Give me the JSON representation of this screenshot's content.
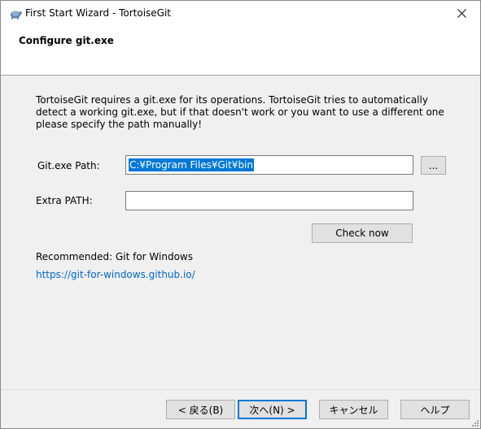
{
  "window": {
    "title": "First Start Wizard - TortoiseGit"
  },
  "header": {
    "title": "Configure git.exe"
  },
  "body": {
    "description": "TortoiseGit requires a git.exe for its operations. TortoiseGit tries to automatically detect a working git.exe, but if that doesn't work or you want to use a different one please specify the path manually!",
    "gitexe_label": "Git.exe Path:",
    "gitexe_value": "C:¥Program Files¥Git¥bin",
    "browse_label": "...",
    "extra_path_label": "Extra PATH:",
    "extra_path_value": "",
    "check_now_label": "Check now",
    "recommended_text": "Recommended: Git for Windows",
    "recommended_link": "https://git-for-windows.github.io/"
  },
  "footer": {
    "back_label": "< 戻る(B)",
    "next_label": "次へ(N) >",
    "cancel_label": "キャンセル",
    "help_label": "ヘルプ"
  },
  "colors": {
    "selection": "#0078d7",
    "link": "#0066cc",
    "accent_border": "#0078d7"
  },
  "icons": [
    "tortoise-icon",
    "close-icon",
    "size-grip-icon"
  ]
}
